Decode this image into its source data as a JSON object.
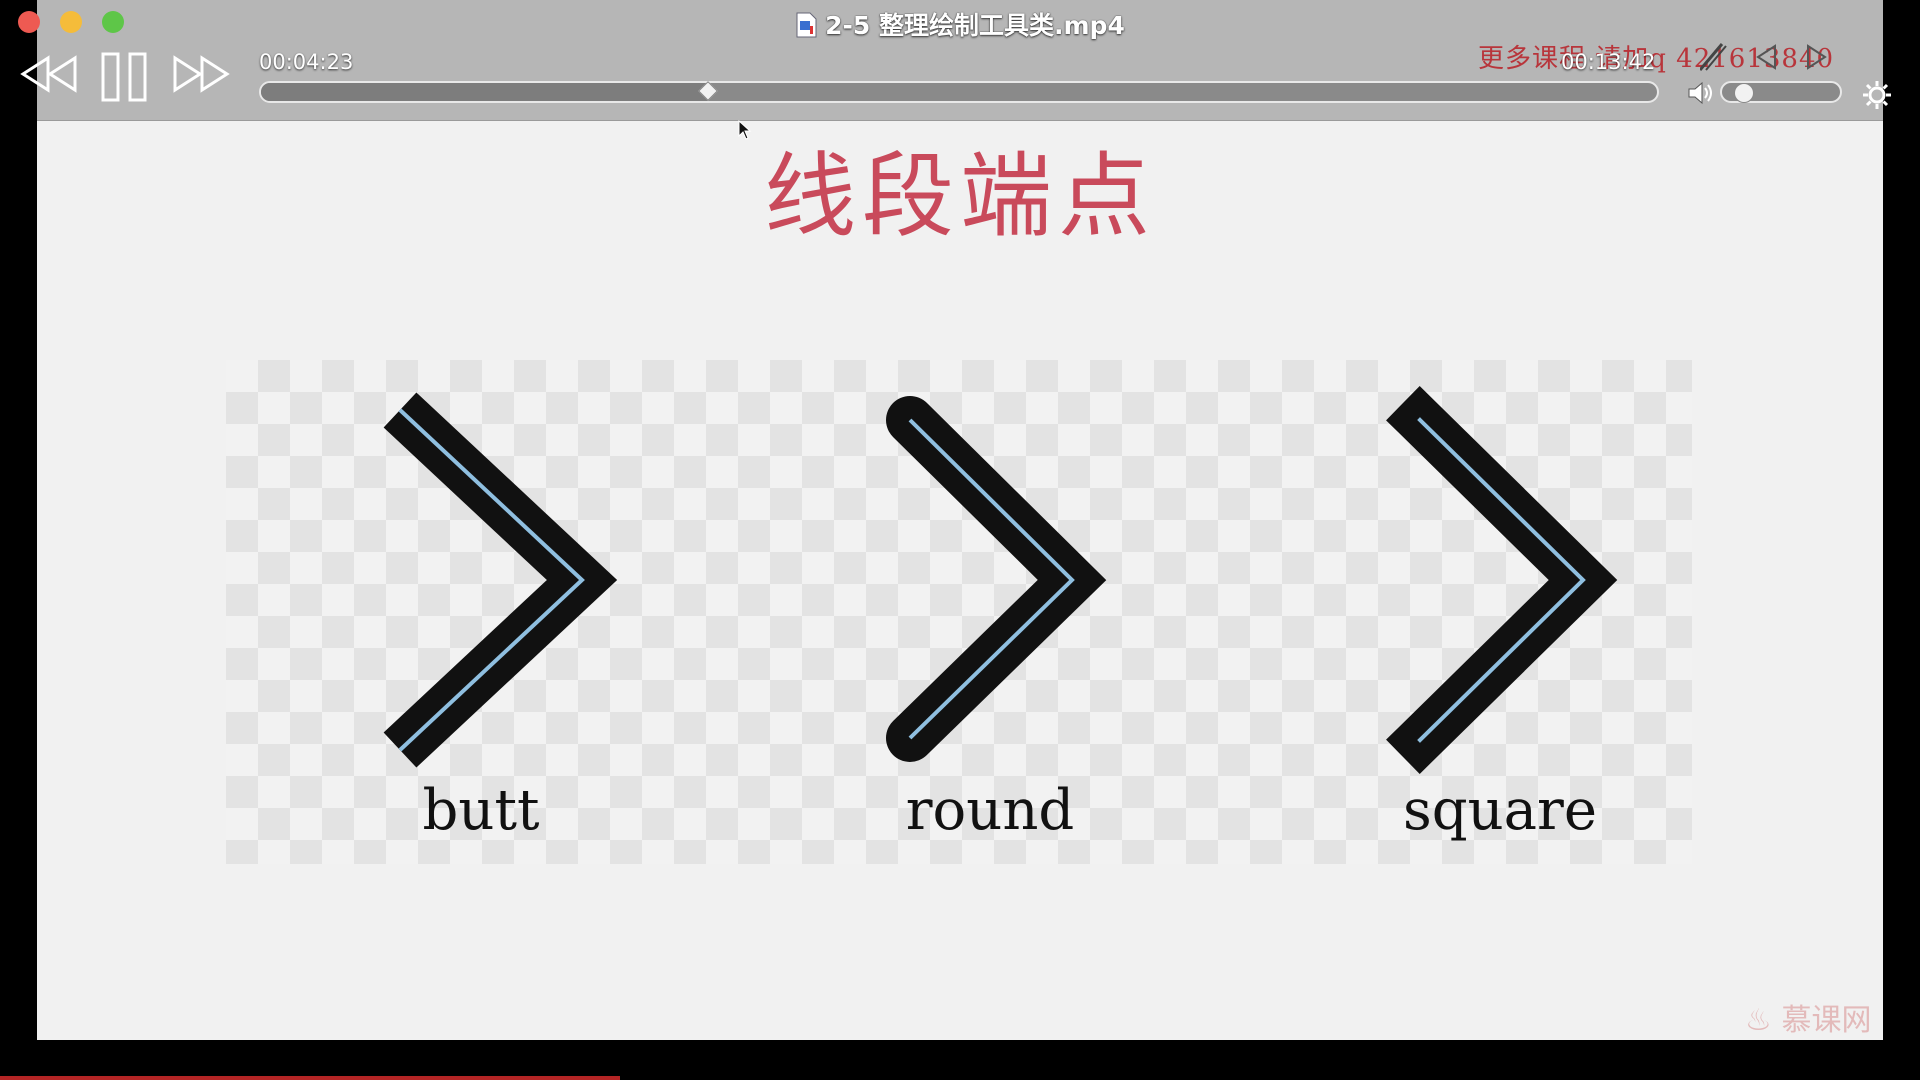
{
  "window": {
    "title": "2-5  整理绘制工具类.mp4"
  },
  "player": {
    "elapsed": "00:04:23",
    "duration": "00:13:42",
    "progress": 0.32,
    "volume": 0.1,
    "watermark_text": "更多课程  请加q  421613840"
  },
  "slide": {
    "title": "线段端点",
    "caps": [
      {
        "label": "butt"
      },
      {
        "label": "round"
      },
      {
        "label": "square"
      }
    ],
    "stroke_color": "#111111",
    "inner_line_color": "#8fbfe0",
    "title_color": "#c94a5b",
    "brand": "慕课网"
  },
  "icons": {
    "rewind": "rewind-icon",
    "pause": "pause-icon",
    "fast_forward": "fast-forward-icon",
    "volume": "speaker-icon",
    "settings": "gear-icon",
    "file": "video-file-icon"
  }
}
